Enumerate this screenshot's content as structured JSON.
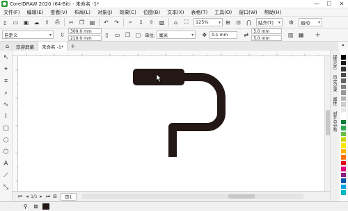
{
  "window": {
    "title": "CorelDRAW 2020 (64-Bit) - 未命名 -1*",
    "min": "—",
    "max": "☐",
    "close": "✕"
  },
  "menu": [
    "文件(F)",
    "编辑(E)",
    "查看(V)",
    "布局(L)",
    "对象(J)",
    "效果(C)",
    "位图(B)",
    "文本(X)",
    "表格(T)",
    "工具(O)",
    "窗口(W)",
    "帮助(H)"
  ],
  "toolbar": {
    "zoom": "125%",
    "snap": "贴齐(T)",
    "launch": "启动"
  },
  "property_bar": {
    "page_size": "自定义",
    "width": "300.0 mm",
    "height": "210.0 mm",
    "unit_label": "单位:",
    "unit": "毫米",
    "nudge": "0.1 mm",
    "dup_x": "5.0 mm",
    "dup_y": "5.0 mm"
  },
  "tabs": {
    "welcome": "欢迎屏幕",
    "document": "未命名 -1*"
  },
  "pages": {
    "page1": "页1"
  },
  "right_panel": {
    "hints": "提示(N)",
    "history": "历史记录",
    "properties": "属性",
    "align": "对齐与分布"
  },
  "colors": {
    "shape": "#231815",
    "palette": [
      "#ffffff",
      "#000000",
      "#1a1a1a",
      "#333333",
      "#4d4d4d",
      "#666666",
      "#808080",
      "#999999",
      "#b3b3b3",
      "#cccccc",
      "#e6e6e6",
      "#ffffff",
      "#0a7a3a",
      "#2da84f",
      "#6cc04a",
      "#c8d400",
      "#ffe600",
      "#ffb000",
      "#ff6e00",
      "#e2001a",
      "#e5007e",
      "#8b1e82",
      "#0057a8",
      "#00a0e9",
      "#00b7c4",
      "#ffffff"
    ]
  },
  "status": {
    "fill": "⊠"
  }
}
